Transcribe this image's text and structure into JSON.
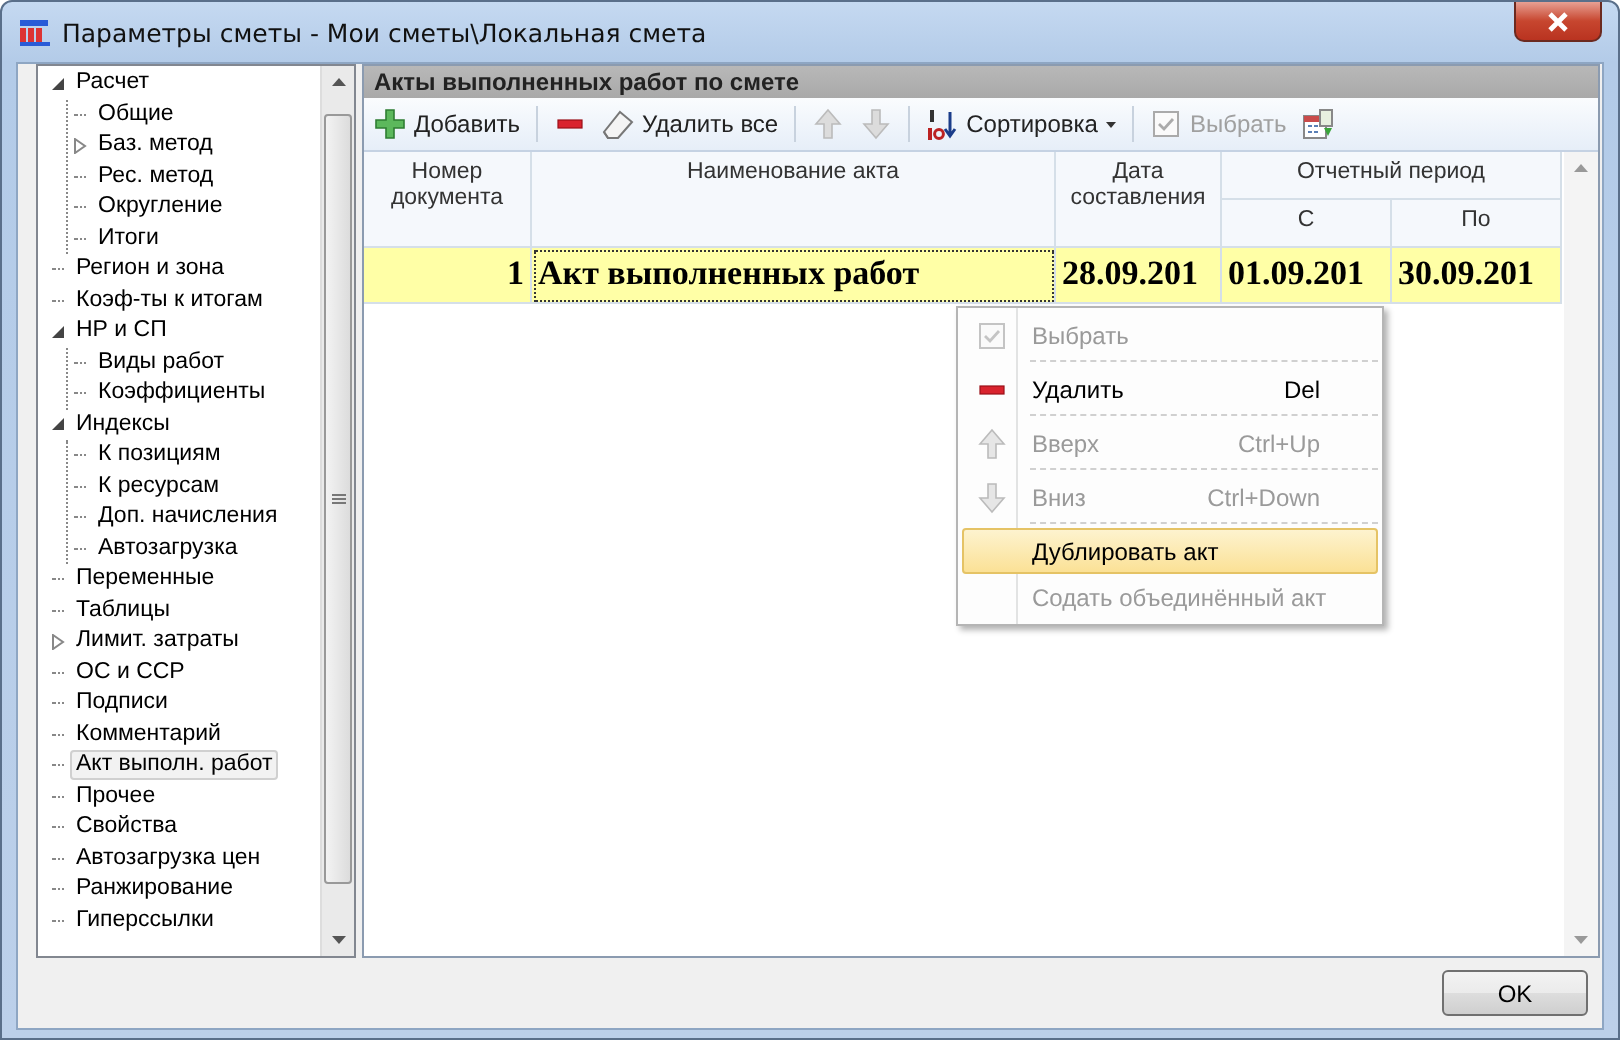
{
  "window": {
    "title": "Параметры сметы - Мои сметы\\Локальная смета"
  },
  "tree": [
    {
      "label": "Расчет",
      "expanded": true,
      "selected": false,
      "children": [
        {
          "label": "Общие",
          "selected": false
        },
        {
          "label": "Баз. метод",
          "expanded": false,
          "selected": false
        },
        {
          "label": "Рес. метод",
          "selected": false
        },
        {
          "label": "Округление",
          "selected": false
        },
        {
          "label": "Итоги",
          "selected": false
        }
      ]
    },
    {
      "label": "Регион и зона",
      "selected": false
    },
    {
      "label": "Коэф-ты к итогам",
      "selected": false
    },
    {
      "label": "НР и СП",
      "expanded": true,
      "selected": false,
      "children": [
        {
          "label": "Виды работ",
          "selected": false
        },
        {
          "label": "Коэффициенты",
          "selected": false
        }
      ]
    },
    {
      "label": "Индексы",
      "expanded": true,
      "selected": false,
      "children": [
        {
          "label": "К позициям",
          "selected": false
        },
        {
          "label": "К ресурсам",
          "selected": false
        },
        {
          "label": "Доп. начисления",
          "selected": false
        },
        {
          "label": "Автозагрузка",
          "selected": false
        }
      ]
    },
    {
      "label": "Переменные",
      "selected": false
    },
    {
      "label": "Таблицы",
      "selected": false
    },
    {
      "label": "Лимит. затраты",
      "expanded": false,
      "selected": false
    },
    {
      "label": "ОС и ССР",
      "selected": false
    },
    {
      "label": "Подписи",
      "selected": false
    },
    {
      "label": "Комментарий",
      "selected": false
    },
    {
      "label": "Акт выполн. работ",
      "selected": true
    },
    {
      "label": "Прочее",
      "selected": false
    },
    {
      "label": "Свойства",
      "selected": false
    },
    {
      "label": "Автозагрузка цен",
      "selected": false
    },
    {
      "label": "Ранжирование",
      "selected": false
    },
    {
      "label": "Гиперссылки",
      "selected": false
    }
  ],
  "panel": {
    "title": "Акты выполненных работ по смете"
  },
  "toolbar": [
    {
      "kind": "add",
      "label": "Добавить",
      "disabled": false
    },
    {
      "kind": "remove",
      "disabled": false
    },
    {
      "kind": "clear",
      "label": "Удалить все",
      "disabled": false
    },
    {
      "kind": "up",
      "disabled": true
    },
    {
      "kind": "down",
      "disabled": true
    },
    {
      "kind": "sort",
      "label": "Сортировка",
      "disabled": false
    },
    {
      "kind": "select",
      "label": "Выбрать",
      "disabled": true
    },
    {
      "kind": "export",
      "disabled": false
    }
  ],
  "table": {
    "columns": [
      "Номер документа",
      "Наименование акта",
      "Дата составления"
    ],
    "group": {
      "label": "Отчетный период",
      "columns": [
        "С",
        "По"
      ]
    },
    "rows": [
      {
        "selected": true,
        "cells": [
          "1",
          "Акт выполненных работ",
          "28.09.201",
          "01.09.201",
          "30.09.201"
        ]
      }
    ]
  },
  "context_menu": {
    "items": [
      {
        "kind": "check",
        "label": "Выбрать",
        "disabled": true,
        "selected": false
      },
      {
        "kind": "minus",
        "label": "Удалить",
        "shortcut": "Del",
        "disabled": false,
        "selected": false
      },
      {
        "kind": "up",
        "label": "Вверх",
        "shortcut": "Ctrl+Up",
        "disabled": true,
        "selected": false
      },
      {
        "kind": "down",
        "label": "Вниз",
        "shortcut": "Ctrl+Down",
        "disabled": true,
        "selected": false
      },
      {
        "kind": "plain",
        "label": "Дублировать акт",
        "disabled": false,
        "selected": true
      },
      {
        "kind": "plain",
        "label": "Содать объединённый акт",
        "disabled": true,
        "selected": false
      }
    ]
  },
  "buttons": [
    "OK"
  ]
}
